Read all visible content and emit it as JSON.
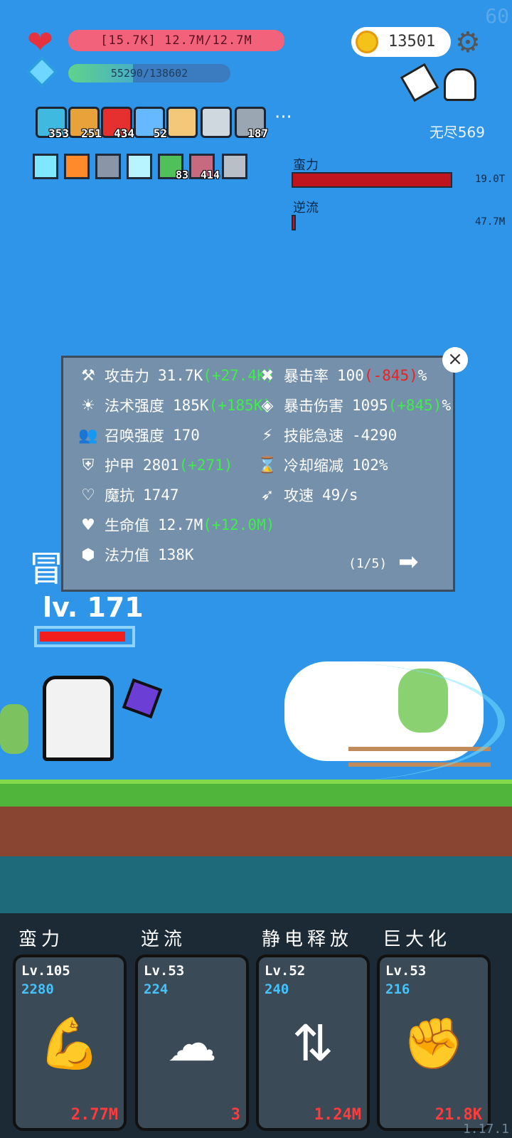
{
  "fps": "60",
  "hp": {
    "text": "[15.7K] 12.7M/12.7M"
  },
  "mp": {
    "text": "55290/138602",
    "fraction": 0.399
  },
  "coins": "13501",
  "endless": "无尽569",
  "items": [
    {
      "icon": "wand-icon",
      "count": "353"
    },
    {
      "icon": "book-icon",
      "count": "251"
    },
    {
      "icon": "apple-icon",
      "count": "434"
    },
    {
      "icon": "star-card-icon",
      "count": "52"
    },
    {
      "icon": "scroll-icon",
      "count": ""
    },
    {
      "icon": "sword-icon",
      "count": ""
    },
    {
      "icon": "cloud-icon",
      "count": "187"
    }
  ],
  "more_label": "···",
  "buffs": [
    {
      "icon": "lightbulb-buff-icon",
      "count": ""
    },
    {
      "icon": "fire-buff-icon",
      "count": ""
    },
    {
      "icon": "helmet-buff-icon",
      "count": ""
    },
    {
      "icon": "lightbulb2-buff-icon",
      "count": ""
    },
    {
      "icon": "leaf-buff-icon",
      "count": "83"
    },
    {
      "icon": "sword-buff-icon",
      "count": "414"
    },
    {
      "icon": "shield-buff-icon",
      "count": ""
    }
  ],
  "active_skills": [
    {
      "name": "蛮力",
      "value": "19.0T",
      "fraction": 1.0
    },
    {
      "name": "逆流",
      "value": "47.7M",
      "fraction": 0.02
    }
  ],
  "stats": {
    "left": [
      {
        "icon": "axe-icon",
        "label": "攻击力",
        "value": "31.7K",
        "bonus": "(+27.4K)",
        "bonus_color": "g"
      },
      {
        "icon": "sun-icon",
        "label": "法术强度",
        "value": "185K",
        "bonus": "(+185K)",
        "bonus_color": "g"
      },
      {
        "icon": "people-icon",
        "label": "召唤强度",
        "value": "170",
        "bonus": "",
        "bonus_color": ""
      },
      {
        "icon": "shield-icon",
        "label": "护甲",
        "value": "2801",
        "bonus": "(+271)",
        "bonus_color": "g"
      },
      {
        "icon": "heart-shield-icon",
        "label": "魔抗",
        "value": "1747",
        "bonus": "",
        "bonus_color": ""
      },
      {
        "icon": "heart-icon",
        "label": "生命值",
        "value": "12.7M",
        "bonus": "(+12.0M)",
        "bonus_color": "g"
      },
      {
        "icon": "gem-icon",
        "label": "法力值",
        "value": "138K",
        "bonus": "",
        "bonus_color": ""
      }
    ],
    "right": [
      {
        "icon": "crossed-swords-icon",
        "label": "暴击率",
        "value": "100",
        "bonus": "(-845)",
        "bonus_color": "r",
        "suffix": "%"
      },
      {
        "icon": "target-icon",
        "label": "暴击伤害",
        "value": "1095",
        "bonus": "(+845)",
        "bonus_color": "g",
        "suffix": "%"
      },
      {
        "icon": "lightning-icon",
        "label": "技能急速",
        "value": "-4290",
        "bonus": "",
        "bonus_color": "",
        "suffix": ""
      },
      {
        "icon": "hourglass-icon",
        "label": "冷却缩减",
        "value": "102%",
        "bonus": "",
        "bonus_color": "",
        "suffix": ""
      },
      {
        "icon": "bow-icon",
        "label": "攻速",
        "value": "49/s",
        "bonus": "",
        "bonus_color": "",
        "suffix": ""
      }
    ],
    "page": "(1/5)"
  },
  "player": {
    "adventure_char": "冒",
    "level": "lv. 171",
    "hp_fraction": 0.95
  },
  "skill_cards": [
    {
      "title": "蛮力",
      "level": "Lv.105",
      "cost": "2280",
      "value": "2.77M",
      "icon": "flexed-arm-icon"
    },
    {
      "title": "逆流",
      "level": "Lv.53",
      "cost": "224",
      "value": "3",
      "icon": "wing-icon"
    },
    {
      "title": "静电释放",
      "level": "Lv.52",
      "cost": "240",
      "value": "1.24M",
      "icon": "swap-arrows-icon"
    },
    {
      "title": "巨大化",
      "level": "Lv.53",
      "cost": "216",
      "value": "21.8K",
      "icon": "fist-icon"
    }
  ],
  "version": "1.17.1",
  "colors": {
    "sky": "#2f95e8",
    "hp": "#f2627a",
    "skill_bar": "#c0141e",
    "cost": "#45c3ff",
    "card_value": "#ff3b3b"
  }
}
